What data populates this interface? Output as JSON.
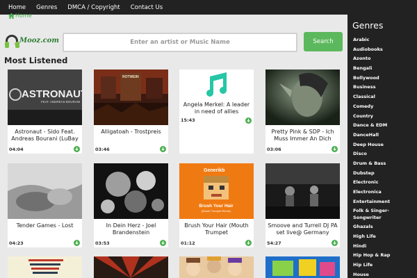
{
  "nav": {
    "items": [
      "Home",
      "Genres",
      "DMCA / Copyright",
      "Contact Us"
    ]
  },
  "breadcrumb": {
    "label": "Home"
  },
  "logo": {
    "text": "Mooz.com"
  },
  "search": {
    "placeholder": "Enter an artist or Music Name",
    "button": "Search"
  },
  "section": {
    "title": "Most Listened"
  },
  "cards": [
    {
      "title": "Astronaut - Sido Feat. Andreas Bourani (LuBay",
      "duration": "04:04"
    },
    {
      "title": "Alligatoah - Trostpreis",
      "duration": "03:46"
    },
    {
      "title": "Angela Merkel: A leader in need of allies",
      "duration": "15:43"
    },
    {
      "title": "Pretty Pink & SDP - Ich Muss Immer An Dich",
      "duration": "03:06"
    },
    {
      "title": "Tender Games - Lost",
      "duration": "04:23"
    },
    {
      "title": "In Dein Herz - Joel Brandenstein",
      "duration": "03:53"
    },
    {
      "title": "Brush Your Hair (Mouth Trumpet",
      "duration": "01:12"
    },
    {
      "title": "Smoove and Turrell DJ PA set live@ Germany",
      "duration": "54:27"
    }
  ],
  "thumb_text": {
    "astronaut": "ASTRONAUT",
    "astronaut_sub": "FEAT. ANDREAS BOURANI",
    "alligatoah_sign": "ROTWEIN",
    "generik": "Generikb",
    "brush": "Brush Your Hair",
    "brush_sub": "(Mouth Trumpet Remix)"
  },
  "sidebar": {
    "title": "Genres",
    "items": [
      "Arabic",
      "Audiobooks",
      "Azonto",
      "Bengali",
      "Bollywood",
      "Business",
      "Classical",
      "Comedy",
      "Country",
      "Dance & EDM",
      "DanceHall",
      "Deep House",
      "Disco",
      "Drum & Bass",
      "Dubstep",
      "Electronic",
      "Electronica",
      "Entertainment",
      "Folk & Singer-Songwriter",
      "Ghazals",
      "High Life",
      "Hindi",
      "Hip Hop & Rap",
      "Hip Life",
      "House"
    ]
  },
  "colors": {
    "accent": "#5cb85c",
    "nav_bg": "#222222",
    "page_bg": "#e9e9ea",
    "music_icon": "#26c6a6"
  }
}
